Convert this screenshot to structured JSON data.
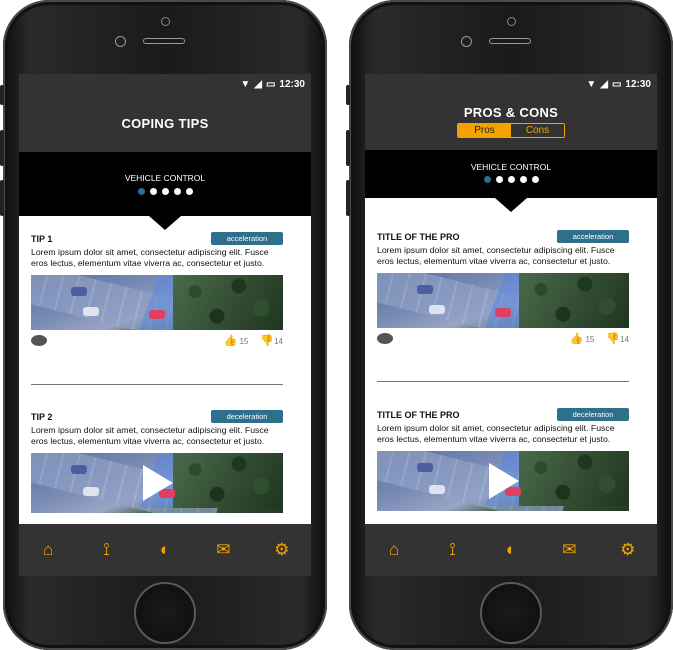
{
  "status": {
    "time": "12:30"
  },
  "accent_color": "#f2a300",
  "tag_color": "#2e6f8c",
  "screen1": {
    "title": "COPING TIPS",
    "carousel_label": "VEHICLE CONTROL",
    "cards": [
      {
        "title": "TIP 1",
        "tag": "acceleration",
        "body": "Lorem ipsum dolor sit amet,  consectetur adipiscing elit. Fusce eros lectus, elementum  vitae viverra ac, consectetur et justo.",
        "likes": "15",
        "dislikes": "14"
      },
      {
        "title": "TIP 2",
        "tag": "deceleration",
        "body": "Lorem ipsum dolor sit amet,  consectetur adipiscing elit. Fusce eros lectus, elementum  vitae viverra ac, consectetur et justo."
      }
    ]
  },
  "screen2": {
    "title": "PROS & CONS",
    "tabs": [
      {
        "label": "Pros",
        "selected": true
      },
      {
        "label": "Cons",
        "selected": false
      }
    ],
    "carousel_label": "VEHICLE CONTROL",
    "cards": [
      {
        "title": "TITLE OF THE  PRO",
        "tag": "acceleration",
        "body": "Lorem ipsum dolor sit amet,  consectetur adipiscing elit. Fusce eros lectus, elementum  vitae viverra ac, consectetur et justo.",
        "likes": "15",
        "dislikes": "14"
      },
      {
        "title": "TITLE OF THE  PRO",
        "tag": "deceleration",
        "body": "Lorem ipsum dolor sit amet,  consectetur adipiscing elit. Fusce eros lectus, elementum  vitae viverra ac, consectetur et justo."
      }
    ]
  },
  "icons": {
    "nav": [
      "home-icon",
      "route-icon",
      "coping-icon",
      "mail-icon",
      "settings-icon"
    ],
    "card": [
      "comment-icon",
      "thumbs-up-icon",
      "thumbs-down-icon",
      "play-icon"
    ],
    "status": [
      "wifi-icon",
      "signal-icon",
      "battery-icon"
    ]
  }
}
